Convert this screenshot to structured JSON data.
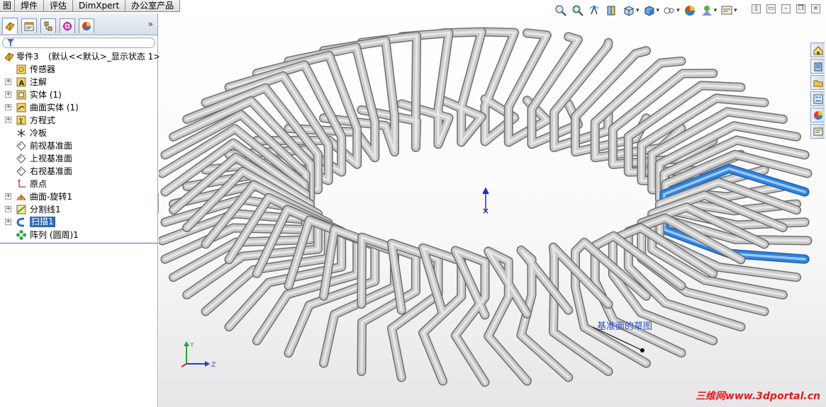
{
  "command_tabs": [
    "图",
    "焊件",
    "评估",
    "DimXpert",
    "办公室产品"
  ],
  "feature_manager": {
    "tabs": [
      {
        "icon": "feature-manager-icon"
      },
      {
        "icon": "property-manager-icon"
      },
      {
        "icon": "configuration-manager-icon"
      },
      {
        "icon": "dimxpert-manager-icon"
      },
      {
        "icon": "display-manager-icon"
      }
    ],
    "expand_glyph": "»",
    "root": {
      "name": "零件3",
      "config": "(默认<<默认>_显示状态 1>)"
    },
    "items": [
      {
        "label": "传感器",
        "icon": "sensor-icon",
        "expandable": false
      },
      {
        "label": "注解",
        "icon": "annotations-icon",
        "expandable": true
      },
      {
        "label": "实体 (1)",
        "icon": "solid-bodies-icon",
        "expandable": true
      },
      {
        "label": "曲面实体 (1)",
        "icon": "surface-bodies-icon",
        "expandable": true
      },
      {
        "label": "方程式",
        "icon": "equations-icon",
        "expandable": true
      },
      {
        "label": "冷板",
        "icon": "material-icon",
        "expandable": false
      },
      {
        "label": "前视基准面",
        "icon": "plane-icon",
        "expandable": false
      },
      {
        "label": "上视基准面",
        "icon": "plane-icon",
        "expandable": false
      },
      {
        "label": "右视基准面",
        "icon": "plane-icon",
        "expandable": false
      },
      {
        "label": "原点",
        "icon": "origin-icon",
        "expandable": false
      },
      {
        "label": "曲面-旋转1",
        "icon": "revolve-surface-icon",
        "expandable": true
      },
      {
        "label": "分割线1",
        "icon": "split-line-icon",
        "expandable": true
      },
      {
        "label": "扫描1",
        "icon": "sweep-icon",
        "expandable": true,
        "selected": true
      },
      {
        "label": "阵列 (圆周)1",
        "icon": "circular-pattern-icon",
        "expandable": false
      }
    ]
  },
  "view_toolbar": [
    {
      "icon": "zoom-to-fit-icon"
    },
    {
      "icon": "zoom-to-area-icon"
    },
    {
      "icon": "previous-view-icon"
    },
    {
      "icon": "section-view-icon"
    },
    {
      "icon": "view-orientation-icon",
      "dropdown": true
    },
    {
      "icon": "display-style-icon",
      "dropdown": true
    },
    {
      "icon": "hide-show-items-icon",
      "dropdown": true
    },
    {
      "icon": "edit-appearance-icon"
    },
    {
      "icon": "apply-scene-icon",
      "dropdown": true
    },
    {
      "icon": "view-settings-icon",
      "dropdown": true
    }
  ],
  "window_controls": [
    {
      "icon": "tile-vertical-icon"
    },
    {
      "icon": "tile-horizontal-icon"
    },
    {
      "icon": "minimize-icon"
    },
    {
      "icon": "restore-icon"
    },
    {
      "icon": "close-icon"
    }
  ],
  "task_pane": [
    {
      "icon": "solidworks-resources-icon"
    },
    {
      "icon": "design-library-icon"
    },
    {
      "icon": "file-explorer-icon"
    },
    {
      "icon": "view-palette-icon"
    },
    {
      "icon": "appearances-scenes-icon"
    },
    {
      "icon": "custom-properties-icon"
    }
  ],
  "graphics": {
    "callout": "基准面的草图",
    "triad_axes": [
      "Y",
      "Z"
    ],
    "watermark": "三维网www.3dportal.cn"
  },
  "colors": {
    "tube": "#c9c9c9",
    "tube_edge": "#6e6e6e",
    "highlight": "#2f86e0",
    "selection": "#3069b8",
    "watermark": "#e02020"
  }
}
